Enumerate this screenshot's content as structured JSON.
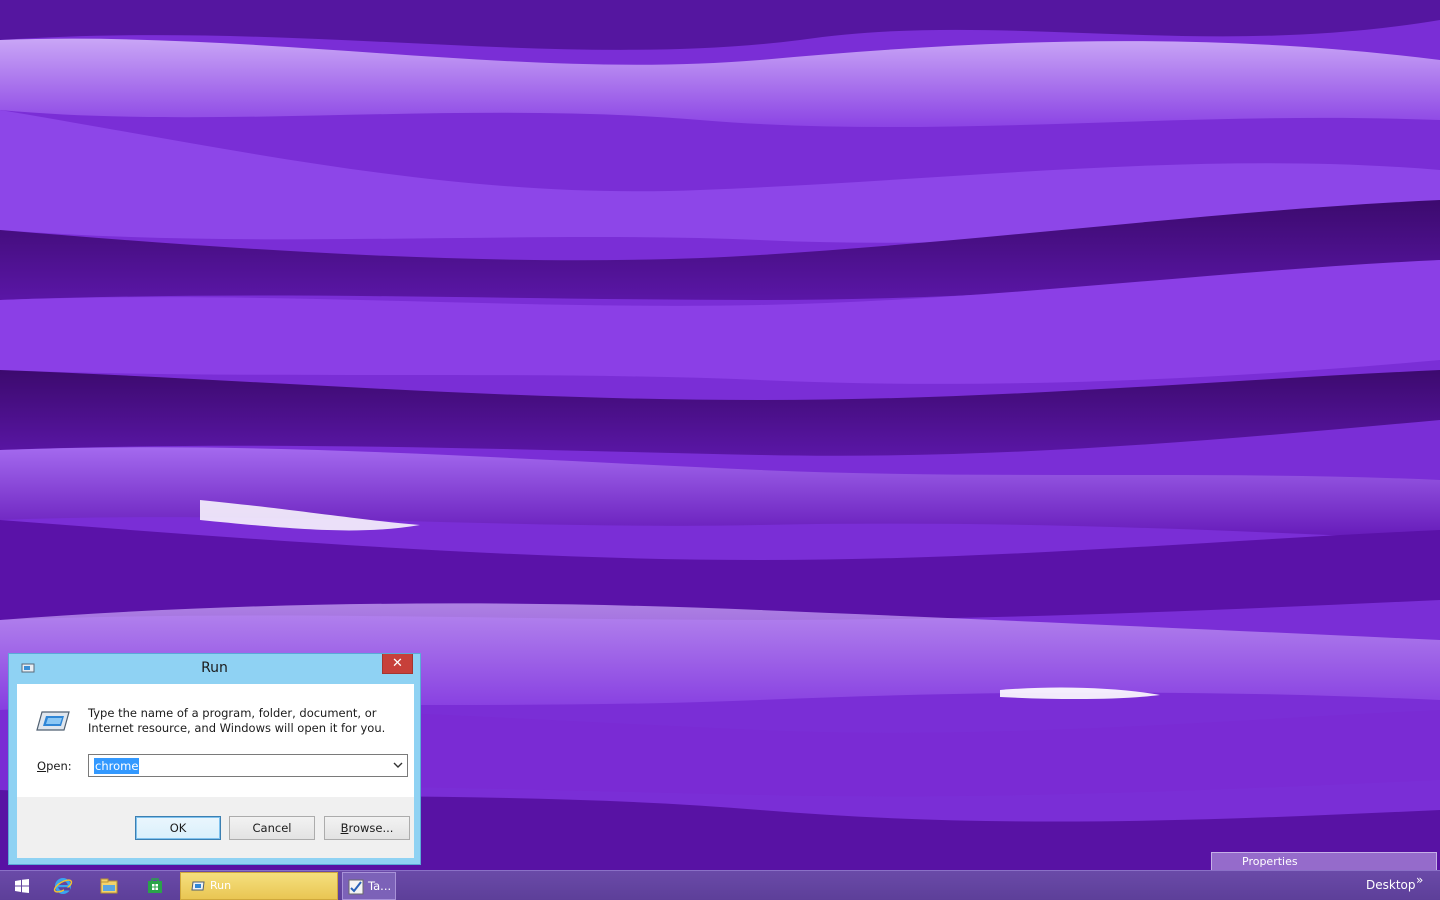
{
  "run_dialog": {
    "title": "Run",
    "close_glyph": "✕",
    "description": "Type the name of a program, folder, document, or Internet resource, and Windows will open it for you.",
    "open_label_mnemonic": "O",
    "open_label_rest": "pen:",
    "open_value": "chrome",
    "ok_label": "OK",
    "cancel_label": "Cancel",
    "browse_mnemonic": "B",
    "browse_rest": "rowse..."
  },
  "taskbar": {
    "run_label": "Run",
    "task_manager_label": "Ta...",
    "desktop_label": "Desktop",
    "chevron": "»"
  },
  "tooltip": {
    "properties_label": "Properties"
  },
  "colors": {
    "wallpaper_primary": "#7424cf",
    "dialog_frame": "#8fd2f3",
    "close_button": "#c7403a",
    "selection": "#3399ff",
    "taskbar": "#5d3f99",
    "active_task": "#e9c653"
  },
  "icons": {
    "start": "windows-logo-icon",
    "ie": "internet-explorer-icon",
    "explorer": "file-explorer-icon",
    "store": "store-icon",
    "run": "run-app-icon",
    "task_manager": "task-manager-icon"
  }
}
